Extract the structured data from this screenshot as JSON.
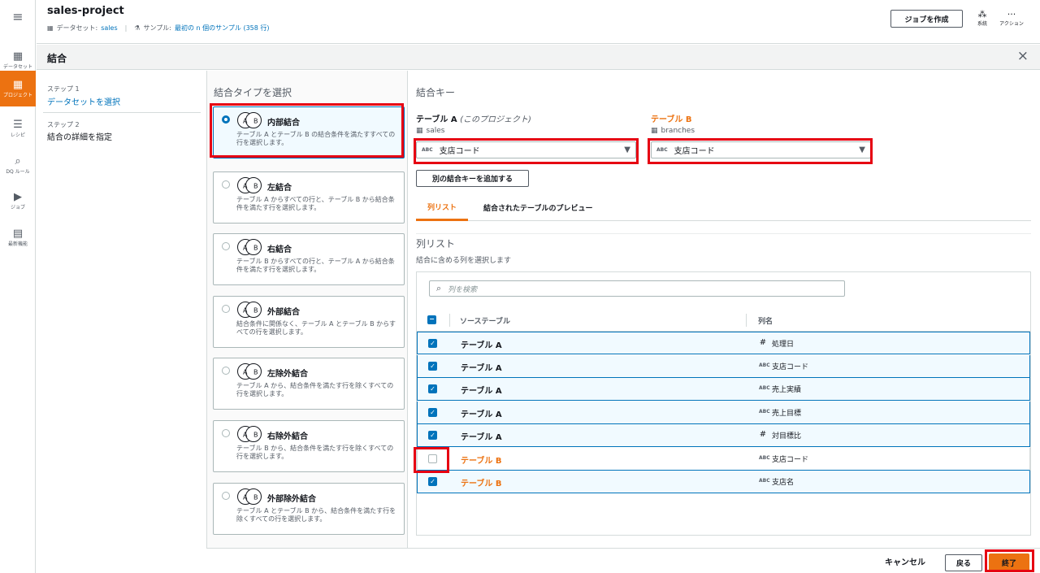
{
  "rail": {
    "items": [
      {
        "label": "データセット",
        "icon": "table-icon"
      },
      {
        "label": "プロジェクト",
        "icon": "project-icon"
      },
      {
        "label": "レシピ",
        "icon": "recipe-icon"
      },
      {
        "label": "DQ ルール",
        "icon": "dq-rules-icon"
      },
      {
        "label": "ジョブ",
        "icon": "job-icon"
      },
      {
        "label": "最新機能",
        "icon": "whats-new-icon"
      }
    ]
  },
  "header": {
    "project_name": "sales-project",
    "dataset_label": "データセット:",
    "dataset_value": "sales",
    "sample_label": "サンプル:",
    "sample_value": "最初の n 個のサンプル (358 行)",
    "create_job": "ジョブを作成",
    "lineage": "系統",
    "actions": "アクション"
  },
  "panel": {
    "title": "結合",
    "close": "×"
  },
  "steps": [
    {
      "label": "ステップ 1",
      "text": "データセットを選択"
    },
    {
      "label": "ステップ 2",
      "text": "結合の詳細を指定"
    }
  ],
  "join_types": {
    "heading": "結合タイプを選択",
    "items": [
      {
        "name": "内部結合",
        "desc": "テーブル A とテーブル B の結合条件を満たすすべての行を選択します。",
        "selected": true
      },
      {
        "name": "左結合",
        "desc": "テーブル A からすべての行と、テーブル B から結合条件を満たす行を選択します。",
        "selected": false
      },
      {
        "name": "右結合",
        "desc": "テーブル B からすべての行と、テーブル A から結合条件を満たす行を選択します。",
        "selected": false
      },
      {
        "name": "外部結合",
        "desc": "結合条件に関係なく、テーブル A とテーブル B からすべての行を選択します。",
        "selected": false
      },
      {
        "name": "左除外結合",
        "desc": "テーブル A から、結合条件を満たす行を除くすべての行を選択します。",
        "selected": false
      },
      {
        "name": "右除外結合",
        "desc": "テーブル B から、結合条件を満たす行を除くすべての行を選択します。",
        "selected": false
      },
      {
        "name": "外部除外結合",
        "desc": "テーブル A とテーブル B から、結合条件を満たす行を除くすべての行を選択します。",
        "selected": false
      }
    ]
  },
  "join_keys": {
    "heading": "結合キー",
    "table_a_label": "テーブル A",
    "table_a_note": "(このプロジェクト)",
    "table_a_source": "sales",
    "table_a_key": "支店コード",
    "table_b_label": "テーブル B",
    "table_b_source": "branches",
    "table_b_key": "支店コード",
    "add_key": "別の結合キーを追加する"
  },
  "tabs": [
    {
      "label": "列リスト",
      "active": true
    },
    {
      "label": "結合されたテーブルのプレビュー",
      "active": false
    }
  ],
  "column_list": {
    "title": "列リスト",
    "subtitle": "結合に含める列を選択します",
    "search_placeholder": "列を検索",
    "col_source": "ソーステーブル",
    "col_name": "列名",
    "rows": [
      {
        "source": "テーブル A",
        "type": "#",
        "column": "処理日",
        "checked": true
      },
      {
        "source": "テーブル A",
        "type": "ABC",
        "column": "支店コード",
        "checked": true
      },
      {
        "source": "テーブル A",
        "type": "ABC",
        "column": "売上実績",
        "checked": true
      },
      {
        "source": "テーブル A",
        "type": "ABC",
        "column": "売上目標",
        "checked": true
      },
      {
        "source": "テーブル A",
        "type": "#",
        "column": "対目標比",
        "checked": true
      },
      {
        "source": "テーブル B",
        "type": "ABC",
        "column": "支店コード",
        "checked": false
      },
      {
        "source": "テーブル B",
        "type": "ABC",
        "column": "支店名",
        "checked": true
      }
    ]
  },
  "footer": {
    "cancel": "キャンセル",
    "back": "戻る",
    "finish": "終了"
  },
  "colors": {
    "accent": "#ec7211",
    "link": "#0073bb",
    "highlight": "#e60012"
  }
}
